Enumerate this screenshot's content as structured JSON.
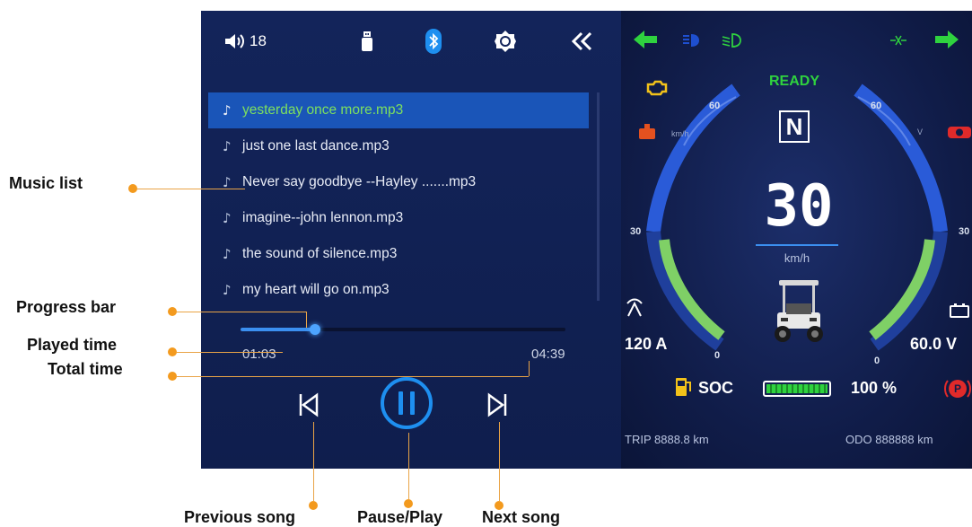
{
  "status_bar": {
    "volume": "18",
    "icons": [
      "speaker-icon",
      "usb-icon",
      "bluetooth-icon",
      "brightness-icon",
      "collapse-icon"
    ]
  },
  "music_list": [
    {
      "title": "yesterday once more.mp3",
      "active": true
    },
    {
      "title": "just one last dance.mp3",
      "active": false
    },
    {
      "title": "Never say goodbye --Hayley .......mp3",
      "active": false
    },
    {
      "title": "imagine--john lennon.mp3",
      "active": false
    },
    {
      "title": "the sound of silence.mp3",
      "active": false
    },
    {
      "title": "my heart will go on.mp3",
      "active": false
    }
  ],
  "player": {
    "played_time": "01:03",
    "total_time": "04:39",
    "progress_fraction": 0.23
  },
  "dashboard": {
    "ready": "READY",
    "gear": "N",
    "speed": "30",
    "speed_unit": "km/h",
    "left_gauge_unit": "km/h",
    "right_gauge_unit": "V",
    "left_ticks": {
      "top": "60",
      "mid": "30",
      "bottom": "0"
    },
    "right_ticks": {
      "top": "60",
      "mid": "30",
      "bottom": "0"
    },
    "current": "120 A",
    "voltage": "60.0 V",
    "soc_label": "SOC",
    "soc_value": "100 %",
    "soc_level": 1.0,
    "trip_label": "TRIP",
    "trip_value": "8888.8 km",
    "odo_label": "ODO",
    "odo_value": "888888 km",
    "colors": {
      "green": "#2fd23f",
      "accent_blue": "#1e6fe0",
      "orange": "#f39a1e",
      "red": "#e02a2a",
      "yellow": "#f2c21a"
    }
  },
  "annotations": {
    "music_list": "Music list",
    "progress_bar": "Progress bar",
    "played_time": "Played time",
    "total_time": "Total time",
    "previous_song": "Previous song",
    "pause_play": "Pause/Play",
    "next_song": "Next song"
  }
}
